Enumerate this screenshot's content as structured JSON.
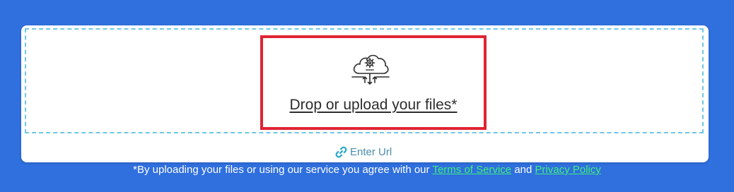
{
  "upload": {
    "label": "Drop or upload your files*",
    "icon": "cloud-settings-icon"
  },
  "url_input": {
    "label": "Enter Url",
    "icon": "link-icon"
  },
  "footer": {
    "prefix": "*By uploading your files or using our service you agree with our",
    "terms_link": "Terms of Service",
    "conjunction": "and",
    "privacy_link": "Privacy Policy"
  },
  "colors": {
    "background": "#2f6fde",
    "dashed_border": "#6ec7e8",
    "highlight_border": "#df2433",
    "link_green": "#3ef07c",
    "url_text": "#4a8caa"
  }
}
